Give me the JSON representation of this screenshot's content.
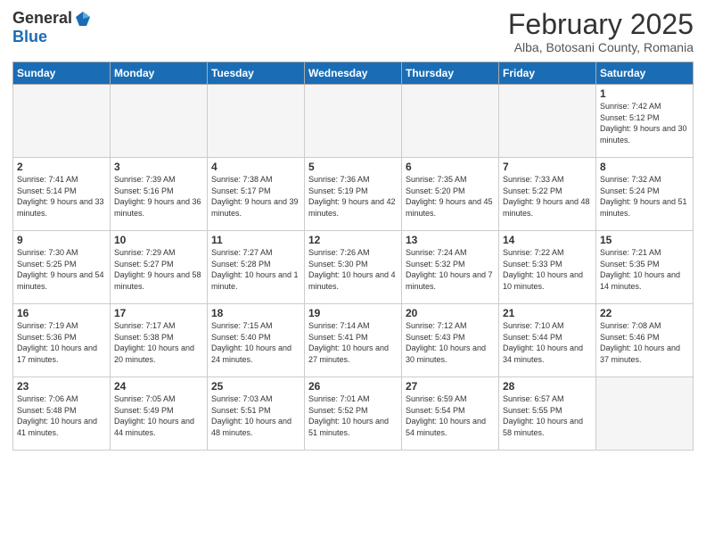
{
  "header": {
    "logo_general": "General",
    "logo_blue": "Blue",
    "month": "February 2025",
    "location": "Alba, Botosani County, Romania"
  },
  "days_of_week": [
    "Sunday",
    "Monday",
    "Tuesday",
    "Wednesday",
    "Thursday",
    "Friday",
    "Saturday"
  ],
  "weeks": [
    [
      {
        "day": "",
        "info": ""
      },
      {
        "day": "",
        "info": ""
      },
      {
        "day": "",
        "info": ""
      },
      {
        "day": "",
        "info": ""
      },
      {
        "day": "",
        "info": ""
      },
      {
        "day": "",
        "info": ""
      },
      {
        "day": "1",
        "info": "Sunrise: 7:42 AM\nSunset: 5:12 PM\nDaylight: 9 hours and 30 minutes."
      }
    ],
    [
      {
        "day": "2",
        "info": "Sunrise: 7:41 AM\nSunset: 5:14 PM\nDaylight: 9 hours and 33 minutes."
      },
      {
        "day": "3",
        "info": "Sunrise: 7:39 AM\nSunset: 5:16 PM\nDaylight: 9 hours and 36 minutes."
      },
      {
        "day": "4",
        "info": "Sunrise: 7:38 AM\nSunset: 5:17 PM\nDaylight: 9 hours and 39 minutes."
      },
      {
        "day": "5",
        "info": "Sunrise: 7:36 AM\nSunset: 5:19 PM\nDaylight: 9 hours and 42 minutes."
      },
      {
        "day": "6",
        "info": "Sunrise: 7:35 AM\nSunset: 5:20 PM\nDaylight: 9 hours and 45 minutes."
      },
      {
        "day": "7",
        "info": "Sunrise: 7:33 AM\nSunset: 5:22 PM\nDaylight: 9 hours and 48 minutes."
      },
      {
        "day": "8",
        "info": "Sunrise: 7:32 AM\nSunset: 5:24 PM\nDaylight: 9 hours and 51 minutes."
      }
    ],
    [
      {
        "day": "9",
        "info": "Sunrise: 7:30 AM\nSunset: 5:25 PM\nDaylight: 9 hours and 54 minutes."
      },
      {
        "day": "10",
        "info": "Sunrise: 7:29 AM\nSunset: 5:27 PM\nDaylight: 9 hours and 58 minutes."
      },
      {
        "day": "11",
        "info": "Sunrise: 7:27 AM\nSunset: 5:28 PM\nDaylight: 10 hours and 1 minute."
      },
      {
        "day": "12",
        "info": "Sunrise: 7:26 AM\nSunset: 5:30 PM\nDaylight: 10 hours and 4 minutes."
      },
      {
        "day": "13",
        "info": "Sunrise: 7:24 AM\nSunset: 5:32 PM\nDaylight: 10 hours and 7 minutes."
      },
      {
        "day": "14",
        "info": "Sunrise: 7:22 AM\nSunset: 5:33 PM\nDaylight: 10 hours and 10 minutes."
      },
      {
        "day": "15",
        "info": "Sunrise: 7:21 AM\nSunset: 5:35 PM\nDaylight: 10 hours and 14 minutes."
      }
    ],
    [
      {
        "day": "16",
        "info": "Sunrise: 7:19 AM\nSunset: 5:36 PM\nDaylight: 10 hours and 17 minutes."
      },
      {
        "day": "17",
        "info": "Sunrise: 7:17 AM\nSunset: 5:38 PM\nDaylight: 10 hours and 20 minutes."
      },
      {
        "day": "18",
        "info": "Sunrise: 7:15 AM\nSunset: 5:40 PM\nDaylight: 10 hours and 24 minutes."
      },
      {
        "day": "19",
        "info": "Sunrise: 7:14 AM\nSunset: 5:41 PM\nDaylight: 10 hours and 27 minutes."
      },
      {
        "day": "20",
        "info": "Sunrise: 7:12 AM\nSunset: 5:43 PM\nDaylight: 10 hours and 30 minutes."
      },
      {
        "day": "21",
        "info": "Sunrise: 7:10 AM\nSunset: 5:44 PM\nDaylight: 10 hours and 34 minutes."
      },
      {
        "day": "22",
        "info": "Sunrise: 7:08 AM\nSunset: 5:46 PM\nDaylight: 10 hours and 37 minutes."
      }
    ],
    [
      {
        "day": "23",
        "info": "Sunrise: 7:06 AM\nSunset: 5:48 PM\nDaylight: 10 hours and 41 minutes."
      },
      {
        "day": "24",
        "info": "Sunrise: 7:05 AM\nSunset: 5:49 PM\nDaylight: 10 hours and 44 minutes."
      },
      {
        "day": "25",
        "info": "Sunrise: 7:03 AM\nSunset: 5:51 PM\nDaylight: 10 hours and 48 minutes."
      },
      {
        "day": "26",
        "info": "Sunrise: 7:01 AM\nSunset: 5:52 PM\nDaylight: 10 hours and 51 minutes."
      },
      {
        "day": "27",
        "info": "Sunrise: 6:59 AM\nSunset: 5:54 PM\nDaylight: 10 hours and 54 minutes."
      },
      {
        "day": "28",
        "info": "Sunrise: 6:57 AM\nSunset: 5:55 PM\nDaylight: 10 hours and 58 minutes."
      },
      {
        "day": "",
        "info": ""
      }
    ]
  ]
}
